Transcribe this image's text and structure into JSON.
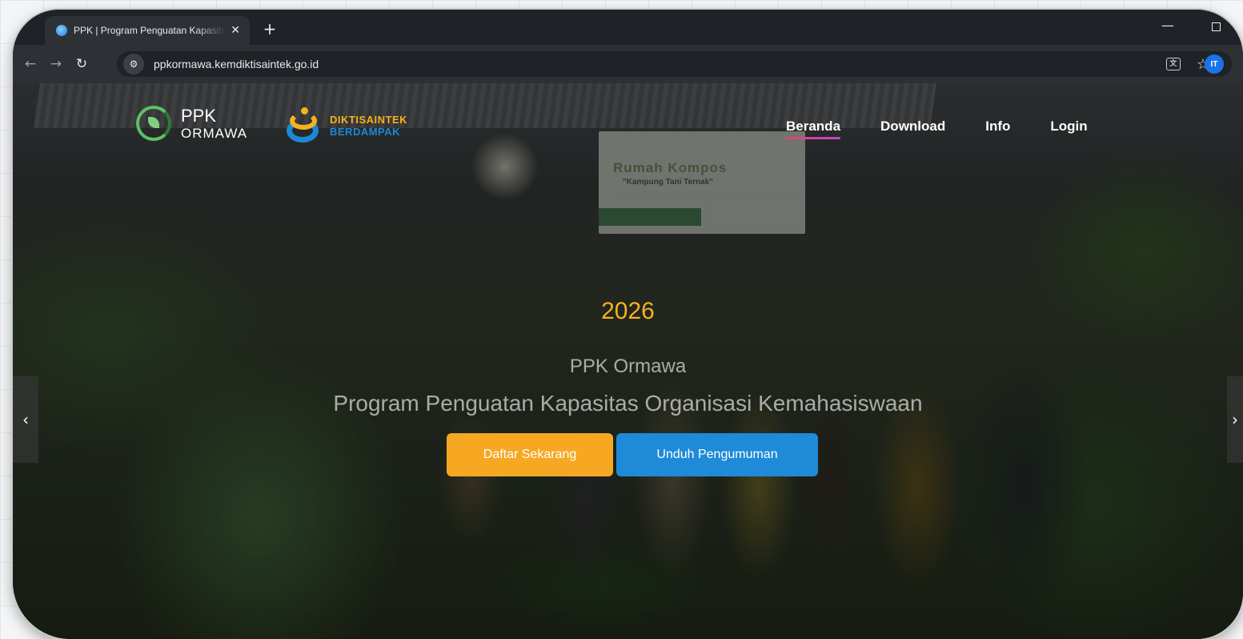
{
  "browser": {
    "tab_title": "PPK | Program Penguatan Kapasitas Organisasi Kemahasiswaan",
    "tab_close": "✕",
    "new_tab": "+",
    "url": "ppkormawa.kemdiktisaintek.go.id",
    "profile_initials": "IT",
    "icons": [
      "back-icon",
      "forward-icon",
      "reload-icon",
      "site-info-icon",
      "translate-icon",
      "star-icon"
    ]
  },
  "site": {
    "brand_line1": "PPK",
    "brand_line2": "ORMAWA",
    "partner_line1": "DIKTISAINTEK",
    "partner_line2": "BERDAMPAK",
    "menu": [
      "Beranda",
      "Download",
      "Info",
      "Login"
    ],
    "active_menu": "Beranda"
  },
  "photo": {
    "banner_title": "Rumah Kompos",
    "banner_sub": "\"Kampung Tani Ternak\""
  },
  "hero": {
    "year": "2026",
    "title": "PPK Ormawa",
    "subtitle": "Program Penguatan Kapasitas Organisasi Kemahasiswaan",
    "primary_button": "Daftar Sekarang",
    "secondary_button": "Unduh Pengumuman"
  },
  "colors": {
    "accent_yellow": "#f7a823",
    "accent_blue": "#1f8ad8",
    "active_underline": "#e8416b"
  }
}
